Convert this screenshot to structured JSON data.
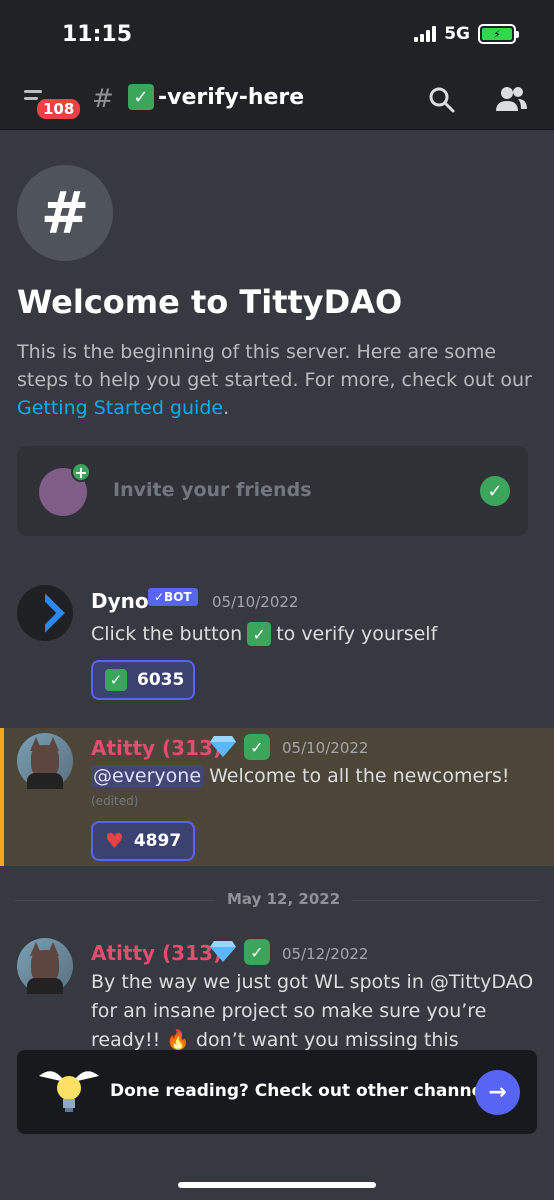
{
  "status": {
    "time": "11:15",
    "network": "5G"
  },
  "header": {
    "badge": "108",
    "channel_name": "-verify-here",
    "channel_emoji": "✓"
  },
  "welcome": {
    "title": "Welcome to TittyDAO",
    "text": "This is the beginning of this server. Here are some steps to help you get started. For more, check out our ",
    "link": "Getting Started guide",
    "after_link": "."
  },
  "invite": {
    "label": "Invite your friends"
  },
  "messages": [
    {
      "author": "Dyno",
      "bot_tag": "✓BOT",
      "timestamp": "05/10/2022",
      "text_before": "Click the button ",
      "text_after": " to verify yourself",
      "reaction_count": "6035"
    },
    {
      "author": "Atitty (313)",
      "timestamp": "05/10/2022",
      "mention": "@everyone",
      "text": " Welcome to all the newcomers!",
      "edited": "(edited)",
      "reaction_count": "4897"
    },
    {
      "author": "Atitty (313)",
      "timestamp": "05/12/2022",
      "text": "By the way we just got  WL spots in @TittyDAO for an insane project so make sure you’re ready!! 🔥 don’t want you missing this"
    }
  ],
  "date_divider": "May 12, 2022",
  "done_card": {
    "text": "Done reading? Check out other channels.",
    "arrow": "→"
  },
  "colors": {
    "background": "#36393f",
    "header": "#202225",
    "accent": "#5865f2",
    "author_red": "#e34d6f",
    "highlight": "#4b4638"
  }
}
